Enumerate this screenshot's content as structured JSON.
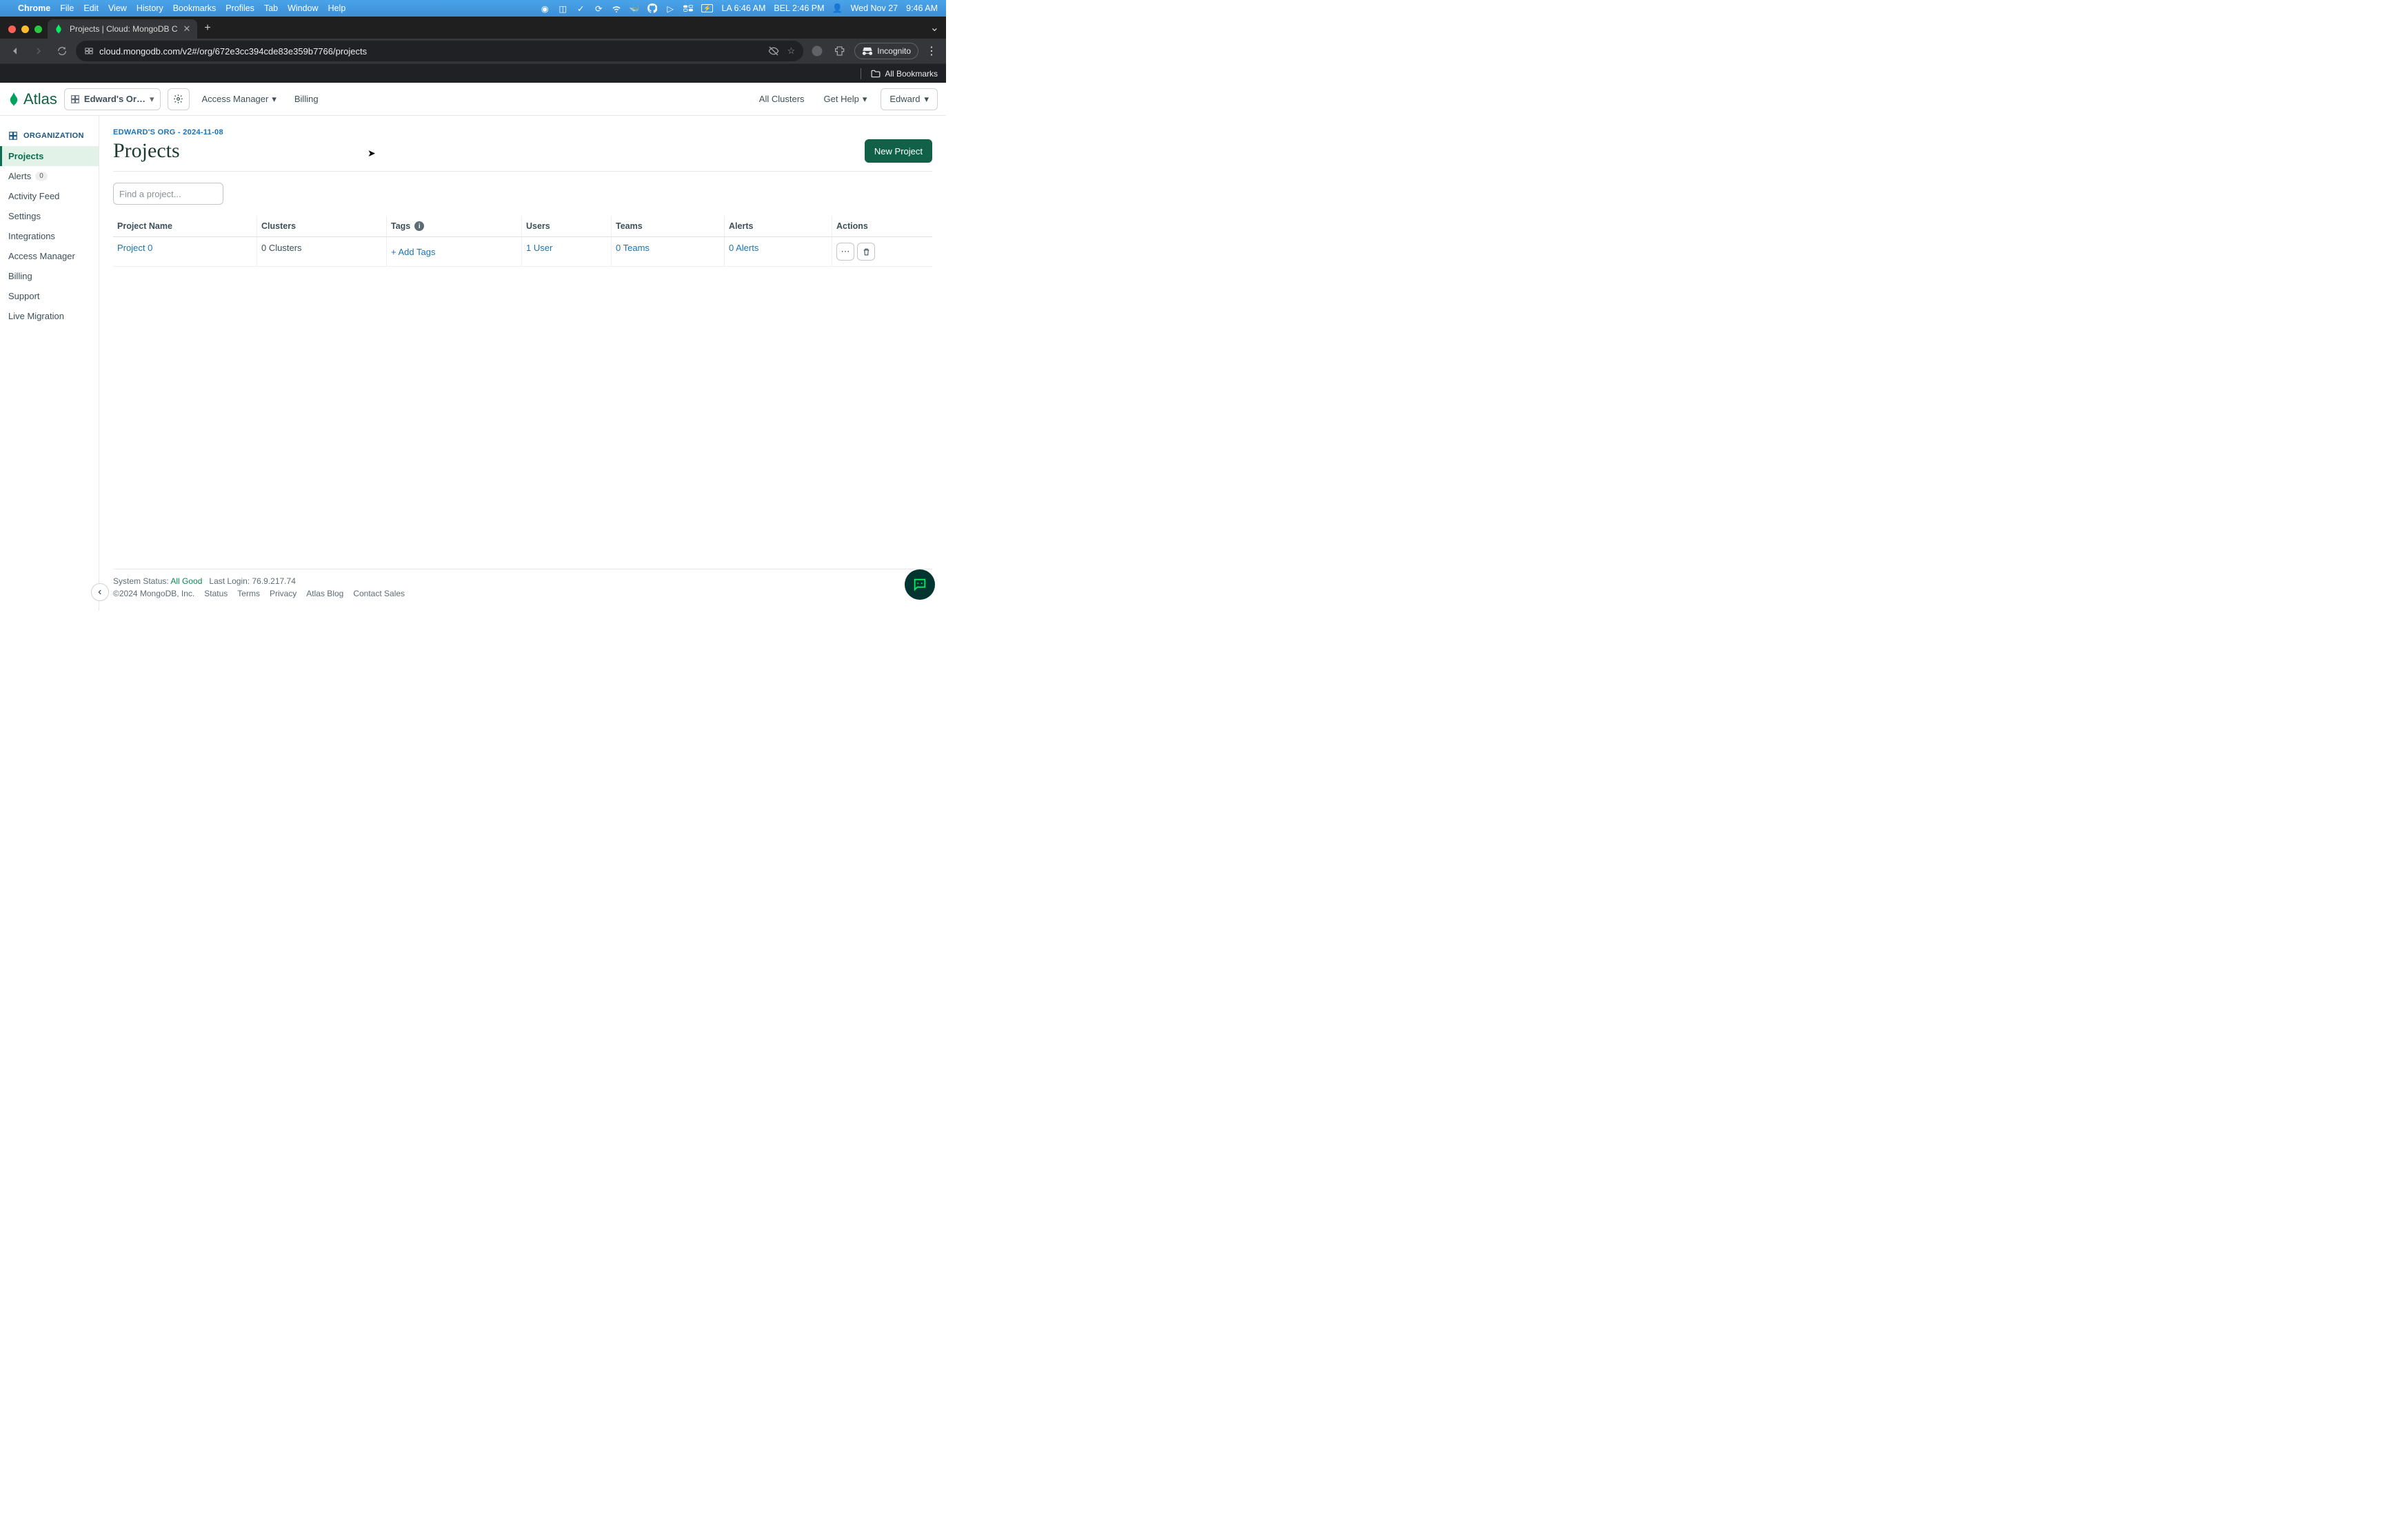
{
  "macos": {
    "menus": [
      "Chrome",
      "File",
      "Edit",
      "View",
      "History",
      "Bookmarks",
      "Profiles",
      "Tab",
      "Window",
      "Help"
    ],
    "battery": "",
    "clock_la": "LA 6:46 AM",
    "clock_bel": "BEL 2:46 PM",
    "date": "Wed Nov 27",
    "time": "9:46 AM"
  },
  "browser": {
    "tab_title": "Projects | Cloud: MongoDB C",
    "url": "cloud.mongodb.com/v2#/org/672e3cc394cde83e359b7766/projects",
    "incognito_label": "Incognito",
    "all_bookmarks": "All Bookmarks"
  },
  "topbar": {
    "product": "Atlas",
    "org_label": "Edward's Or…",
    "access_manager": "Access Manager",
    "billing": "Billing",
    "all_clusters": "All Clusters",
    "get_help": "Get Help",
    "user": "Edward"
  },
  "sidebar": {
    "section": "ORGANIZATION",
    "items": [
      {
        "label": "Projects",
        "active": true
      },
      {
        "label": "Alerts",
        "badge": "0"
      },
      {
        "label": "Activity Feed"
      },
      {
        "label": "Settings"
      },
      {
        "label": "Integrations"
      },
      {
        "label": "Access Manager"
      },
      {
        "label": "Billing"
      },
      {
        "label": "Support"
      },
      {
        "label": "Live Migration"
      }
    ]
  },
  "page": {
    "breadcrumb": "EDWARD'S ORG - 2024-11-08",
    "title": "Projects",
    "new_project": "New Project",
    "search_placeholder": "Find a project..."
  },
  "table": {
    "headers": {
      "name": "Project Name",
      "clusters": "Clusters",
      "tags": "Tags",
      "users": "Users",
      "teams": "Teams",
      "alerts": "Alerts",
      "actions": "Actions"
    },
    "rows": [
      {
        "name": "Project 0",
        "clusters": "0 Clusters",
        "tags": "+ Add Tags",
        "users": "1 User",
        "teams": "0 Teams",
        "alerts": "0 Alerts"
      }
    ]
  },
  "footer": {
    "status_label": "System Status:",
    "status_value": "All Good",
    "last_login_label": "Last Login:",
    "last_login_value": "76.9.217.74",
    "copyright": "©2024 MongoDB, Inc.",
    "links": [
      "Status",
      "Terms",
      "Privacy",
      "Atlas Blog",
      "Contact Sales"
    ]
  }
}
